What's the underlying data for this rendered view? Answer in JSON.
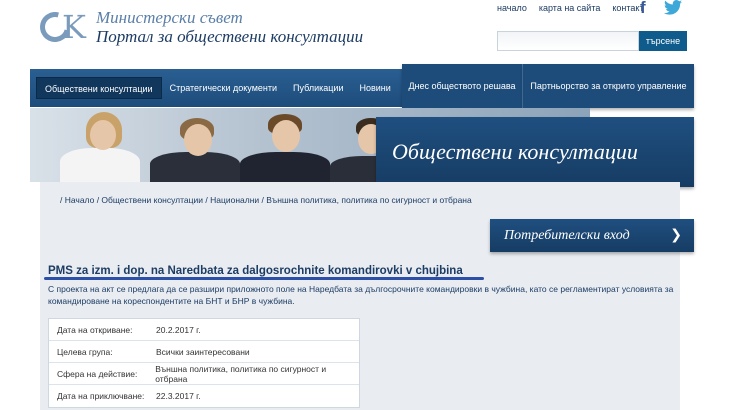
{
  "header": {
    "logo_line1": "Министерски съвет",
    "logo_line2": "Портал за обществени консултации",
    "toplinks": [
      "начало",
      "карта на сайта",
      "контакт"
    ],
    "search_placeholder": "",
    "search_button": "търсене"
  },
  "nav": {
    "items": [
      "Обществени консултации",
      "Стратегически документи",
      "Публикации",
      "Новини"
    ],
    "right_items": [
      "Днес обществото решава",
      "Партньорство за открито управление"
    ]
  },
  "banner": {
    "title": "Обществени консултации"
  },
  "breadcrumb": "/ Начало / Обществени консултации / Национални / Външна политика, политика по сигурност и отбрана",
  "login": {
    "label": "Потребителски вход",
    "arrow": "❯"
  },
  "page": {
    "title": "PMS za izm. i dop. na Naredbata za dalgosrochnite komandirovki v chujbina",
    "description": "С проекта на акт се предлага да се разшири приложното поле на Наредбата за дългосрочните командировки в чужбина, като се регламентират условията за командироване на кореспондентите на БНТ и БНР в чужбина."
  },
  "info": [
    {
      "key": "Дата на откриване:",
      "value": "20.2.2017 г."
    },
    {
      "key": "Целева група:",
      "value": "Всички заинтересовани"
    },
    {
      "key": "Сфера на действие:",
      "value": "Външна политика, политика по сигурност и отбрана"
    },
    {
      "key": "Дата на приключване:",
      "value": "22.3.2017 г."
    }
  ],
  "colors": {
    "primary": "#1d4c7b",
    "accent": "#2c4fa8",
    "background": "#e9edf2"
  }
}
